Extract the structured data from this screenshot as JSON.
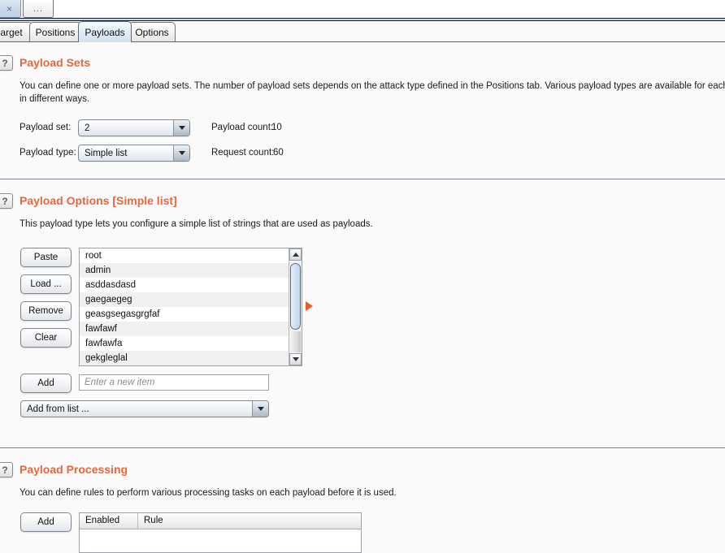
{
  "window_tabs": {
    "close_label": "×",
    "more_label": "..."
  },
  "main_tabs": [
    {
      "id": "target",
      "label": "arget",
      "active": false
    },
    {
      "id": "positions",
      "label": "Positions",
      "active": false
    },
    {
      "id": "payloads",
      "label": "Payloads",
      "active": true
    },
    {
      "id": "options",
      "label": "Options",
      "active": false
    }
  ],
  "colors": {
    "section_heading": "#e8663c",
    "page_background": "#fafafa",
    "marker_arrow": "#f05a28",
    "active_tab": "#d2e1f0",
    "scroll_thumb": "#bfd8ee"
  },
  "help_badge_label": "?",
  "payload_sets": {
    "title": "Payload Sets",
    "description_line1": "You can define one or more payload sets. The number of payload sets depends on the attack type defined in the Positions tab. Various payload types are available for each payload",
    "description_line2": "in different ways.",
    "payload_set_label": "Payload set:",
    "payload_set_value": "2",
    "payload_type_label": "Payload type:",
    "payload_type_value": "Simple list",
    "payload_count_label": "Payload count:",
    "payload_count_value": "10",
    "request_count_label": "Request count:",
    "request_count_value": "60"
  },
  "payload_options": {
    "title": "Payload Options [Simple list]",
    "description": "This payload type lets you configure a simple list of strings that are used as payloads.",
    "buttons": [
      {
        "id": "paste",
        "label": "Paste"
      },
      {
        "id": "load",
        "label": "Load ..."
      },
      {
        "id": "remove",
        "label": "Remove"
      },
      {
        "id": "clear",
        "label": "Clear"
      }
    ],
    "items": [
      "root",
      "admin",
      "asddasdasd",
      "gaegaegeg",
      "geasgsegasgrgfaf",
      "fawfawf",
      "fawfawfa",
      "gekgleglal"
    ],
    "add_button_label": "Add",
    "new_item_placeholder": "Enter a new item",
    "add_from_list_label": "Add from list ..."
  },
  "payload_processing": {
    "title": "Payload Processing",
    "description": "You can define rules to perform various processing tasks on each payload before it is used.",
    "add_button_label": "Add",
    "columns": [
      "Enabled",
      "Rule"
    ],
    "rows": []
  }
}
